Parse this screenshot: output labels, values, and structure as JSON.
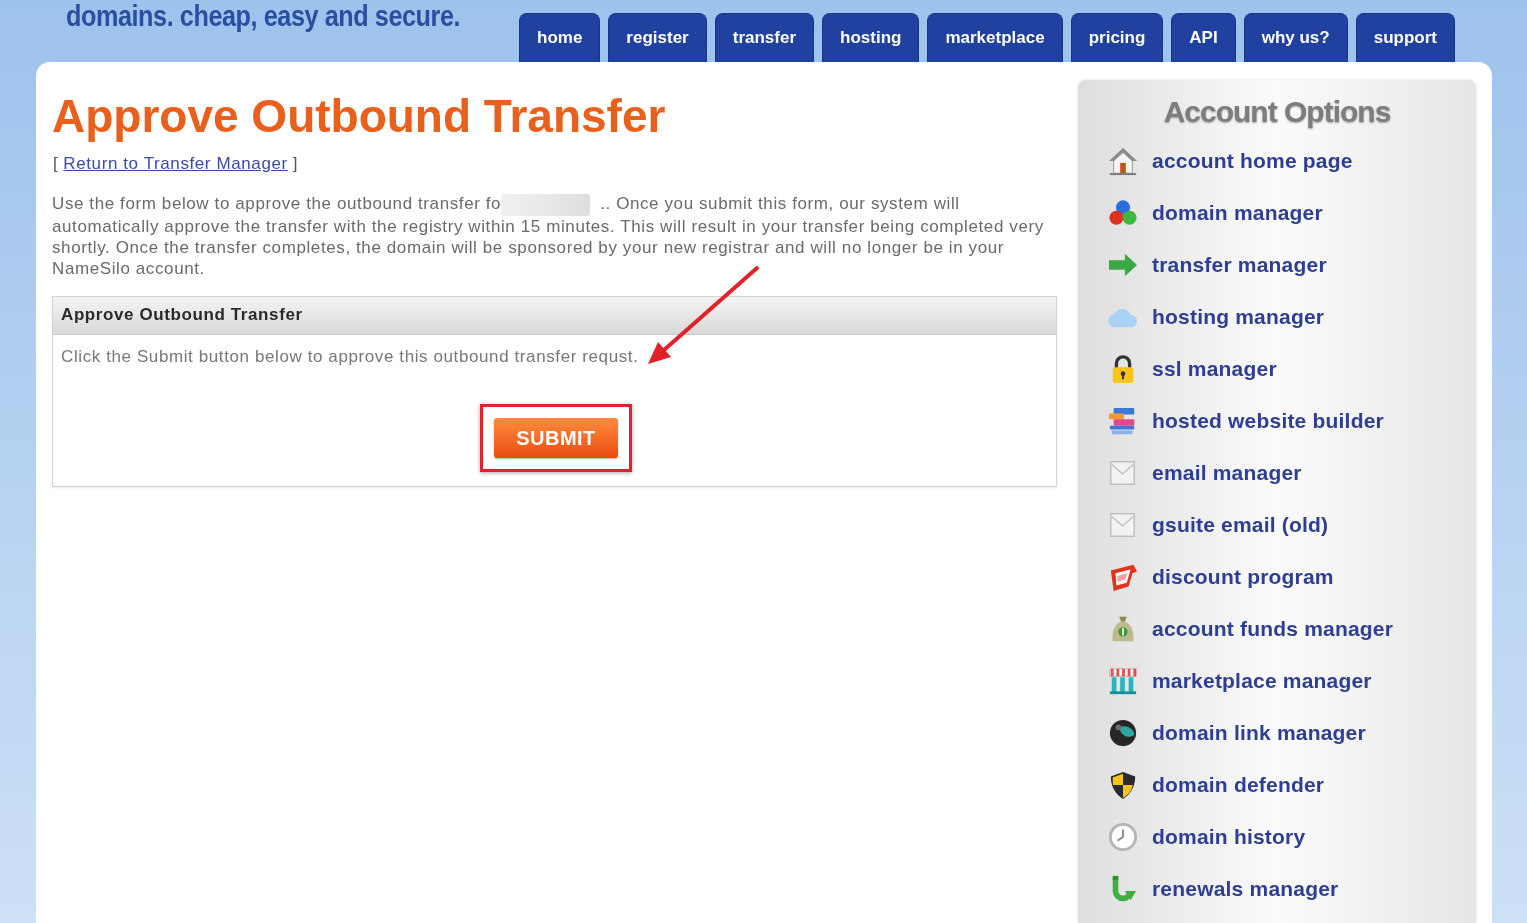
{
  "header": {
    "tagline": "domains. cheap, easy and secure.",
    "nav": [
      "home",
      "register",
      "transfer",
      "hosting",
      "marketplace",
      "pricing",
      "API",
      "why us?",
      "support"
    ]
  },
  "main": {
    "title": "Approve Outbound Transfer",
    "return_link": {
      "open": "[",
      "label": "Return to Transfer Manager",
      "close": "]"
    },
    "intro": {
      "before": "Use the form below to approve the outbound transfer fo",
      "redacted": true,
      "after": ".. Once you submit this form, our system will automatically approve the transfer with the registry within 15 minutes. This will result in your transfer being completed very shortly. Once the transfer completes, the domain will be sponsored by your new registrar and will no longer be in your NameSilo account."
    },
    "panel": {
      "title": "Approve Outbound Transfer",
      "message": "Click the Submit button below to approve this outbound transfer requst.",
      "arrow_to_message": true,
      "submit": {
        "label": "SUBMIT",
        "highlighted": true
      }
    }
  },
  "sidebar": {
    "title": "Account Options",
    "items": [
      "account home page",
      "domain manager",
      "transfer manager",
      "hosting manager",
      "ssl manager",
      "hosted website builder",
      "email manager",
      "gsuite email (old)",
      "discount program",
      "account funds manager",
      "marketplace manager",
      "domain link manager",
      "domain defender",
      "domain history",
      "renewals manager"
    ]
  }
}
